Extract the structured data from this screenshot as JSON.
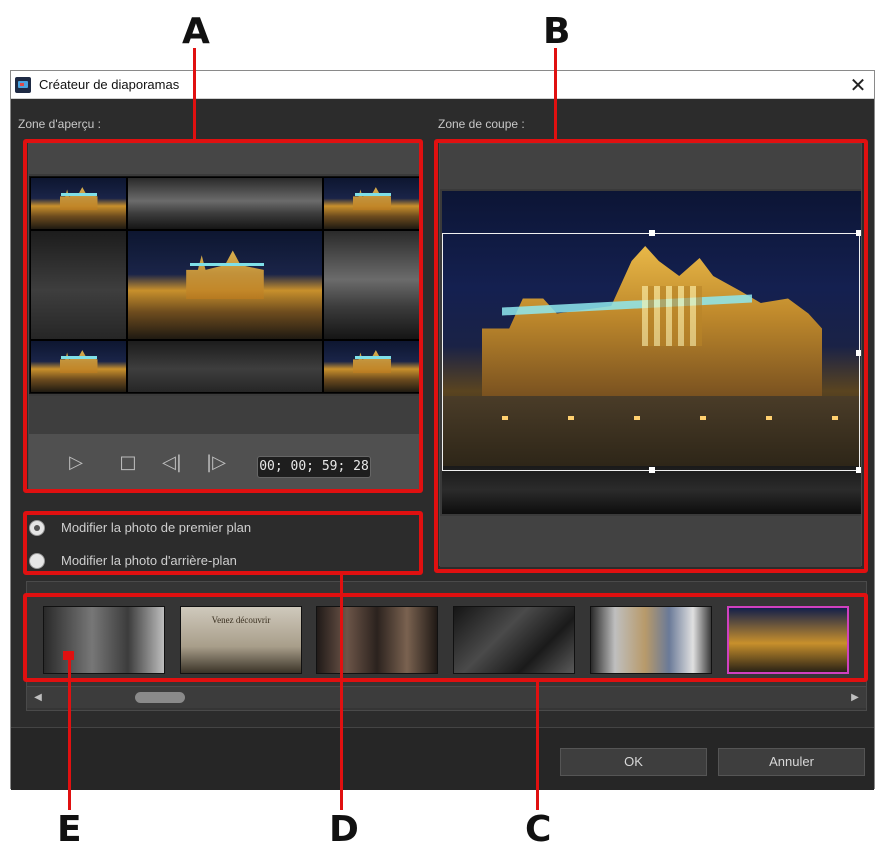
{
  "callouts": [
    "A",
    "B",
    "C",
    "D",
    "E"
  ],
  "window": {
    "title": "Créateur de diaporamas",
    "close_glyph": "✕"
  },
  "preview": {
    "label": "Zone d'aperçu :",
    "timecode": "00; 00; 59; 28",
    "controls": [
      "play-icon",
      "stop-icon",
      "prev-frame-icon",
      "next-frame-icon"
    ]
  },
  "crop": {
    "label": "Zone de coupe :"
  },
  "options": {
    "foreground_label": "Modifier la photo de premier plan",
    "background_label": "Modifier la photo d'arrière-plan",
    "selected": "foreground"
  },
  "thumbnails": [
    {
      "text": ""
    },
    {
      "text": "Venez découvrir"
    },
    {
      "text": ""
    },
    {
      "text": ""
    },
    {
      "text": ""
    },
    {
      "text": "",
      "selected": true
    }
  ],
  "buttons": {
    "ok": "OK",
    "cancel": "Annuler"
  },
  "colors": {
    "callout": "#e01010",
    "selection": "#d040c0",
    "window_bg": "#2c2c2c"
  }
}
